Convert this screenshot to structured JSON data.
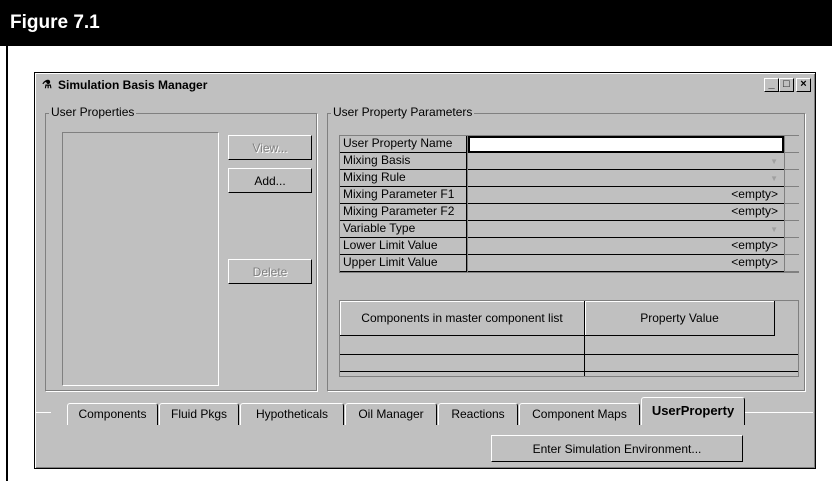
{
  "figure": {
    "title": "Figure 7.1"
  },
  "window": {
    "title": "Simulation Basis Manager",
    "controls": {
      "minimize": "_",
      "maximize": "□",
      "close": "×"
    }
  },
  "user_properties": {
    "group_label": "User Properties",
    "buttons": {
      "view": "View...",
      "add": "Add...",
      "delete": "Delete"
    }
  },
  "parameters": {
    "group_label": "User Property Parameters",
    "rows": [
      {
        "label": "User Property Name",
        "value": ""
      },
      {
        "label": "Mixing Basis",
        "value": ""
      },
      {
        "label": "Mixing Rule",
        "value": ""
      },
      {
        "label": "Mixing Parameter F1",
        "value": "<empty>"
      },
      {
        "label": "Mixing Parameter F2",
        "value": "<empty>"
      },
      {
        "label": "Variable Type",
        "value": ""
      },
      {
        "label": "Lower Limit Value",
        "value": "<empty>"
      },
      {
        "label": "Upper Limit Value",
        "value": "<empty>"
      }
    ],
    "components_table": {
      "col1": "Components in master component list",
      "col2": "Property Value"
    }
  },
  "tabs": [
    "Components",
    "Fluid Pkgs",
    "Hypotheticals",
    "Oil Manager",
    "Reactions",
    "Component Maps",
    "UserProperty"
  ],
  "active_tab": "UserProperty",
  "enter_button": "Enter Simulation Environment...",
  "colors": {
    "face": "#c0c0c0",
    "shadow": "#808080",
    "highlight": "#ffffff",
    "header": "#000000"
  }
}
